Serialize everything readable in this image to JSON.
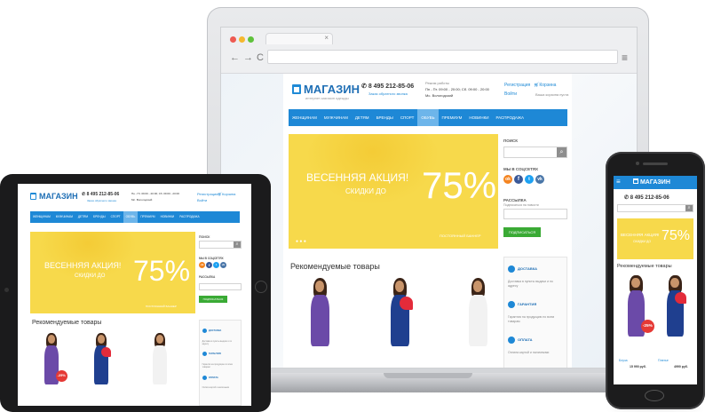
{
  "site": {
    "logo_text": "МАГАЗИН",
    "logo_sub": "интернет-магазин одежды",
    "phone": "8 495 212-85-06",
    "callback": "Заказ обратного звонка",
    "hours_title": "Режим работы",
    "hours": "Пн - Пт. 09:00 - 20:00; Сб. 09:00 - 20:00",
    "address": "Мс. Вологодский",
    "register": "Регистрация",
    "login": "Войти",
    "cart": "Корзина",
    "cart_sub": "Ваша корзина пуста",
    "nav": [
      "ЖЕНЩИНАМ",
      "МУЖЧИНАМ",
      "ДЕТЯМ",
      "БРЕНДЫ",
      "СПОРТ",
      "ОБУВЬ",
      "ПРЕМИУМ",
      "НОВИНКИ",
      "РАСПРОДАЖА"
    ],
    "nav_active_index": 5,
    "banner_title": "ВЕСЕННЯЯ АКЦИЯ!",
    "banner_sub": "СКИДКИ ДО",
    "banner_pct": "75%",
    "banner_more": "ПОСТОЯННЫЙ БАННЕР",
    "search_label": "ПОИСК",
    "social_label": "МЫ В СОЦСЕТЯХ",
    "social": [
      "ok",
      "f",
      "tw",
      "vk"
    ],
    "subscribe_label": "РАССЫЛКА",
    "subscribe_sub": "Подписаться на новости",
    "subscribe_btn": "ПОДПИСАТЬСЯ",
    "featured_title": "Рекомендуемые товары",
    "info": [
      {
        "title": "ДОСТАВКА",
        "text": "Доставка в пункты выдачи и по адресу"
      },
      {
        "title": "ГАРАНТИЯ",
        "text": "Гарантия на продукцию по всем товарам"
      },
      {
        "title": "ОПЛАТА",
        "text": "Оплата картой и наличными"
      }
    ],
    "badge": "-25%",
    "phone_prices": [
      "15 990 руб.",
      "4990 руб."
    ],
    "phone_item_names": [
      "Блуза",
      "Платье"
    ]
  },
  "colors": {
    "nav_blue": "#1e88d6",
    "banner_yellow": "#f7d94b",
    "subscribe_green": "#3aaa35",
    "badge_red": "#e53935"
  }
}
